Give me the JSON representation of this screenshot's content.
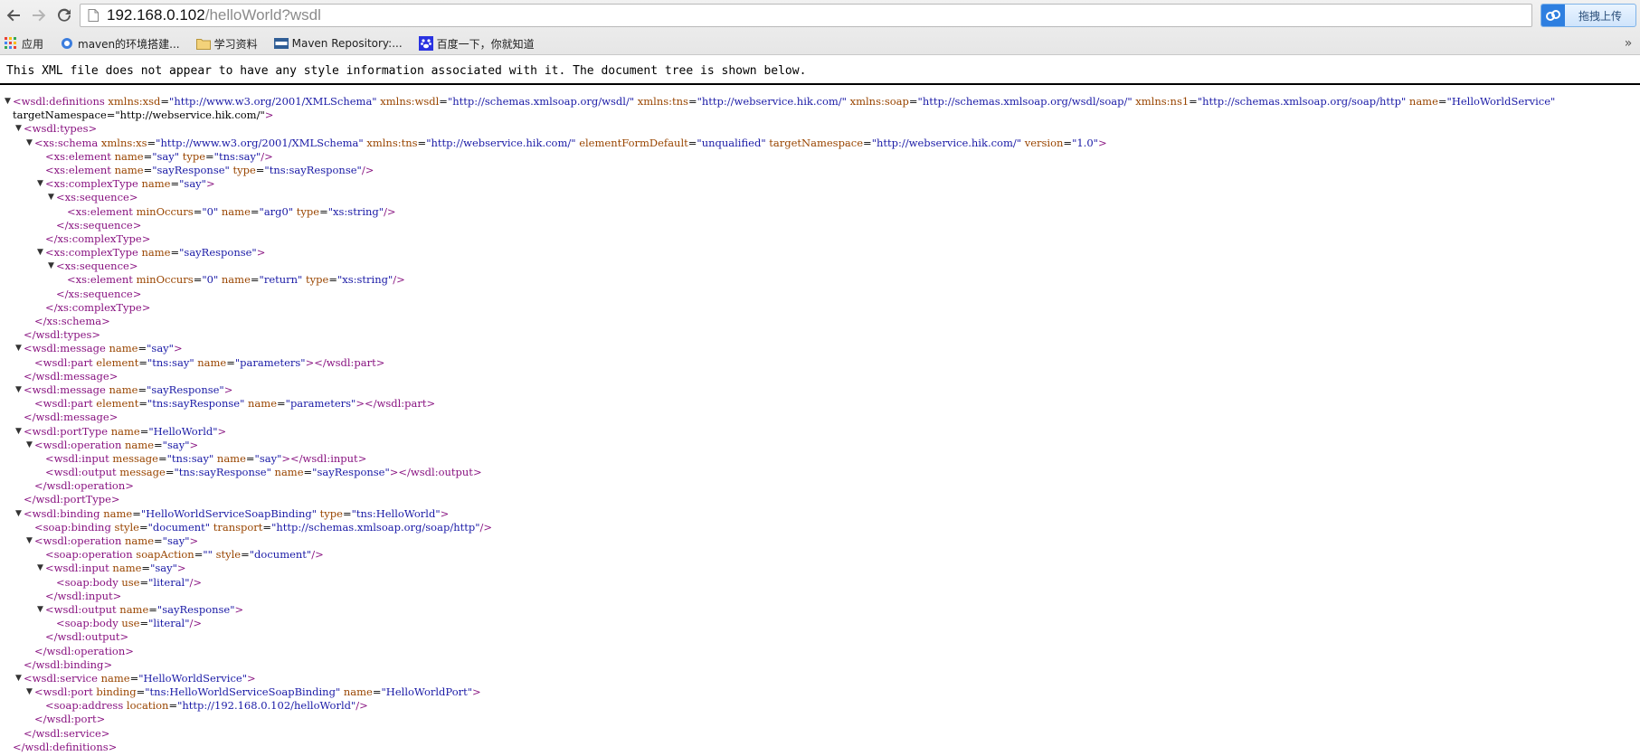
{
  "toolbar": {
    "back_icon": "back-arrow-icon",
    "forward_icon": "forward-arrow-icon",
    "reload_icon": "reload-icon",
    "url_host": "192.168.0.102",
    "url_path": "/helloWorld?wsdl",
    "extension_label": "拖拽上传",
    "extension_icon": "cloud-icon"
  },
  "bookmarks": [
    {
      "label": "应用",
      "icon": "apps-grid-icon"
    },
    {
      "label": "maven的环境搭建...",
      "icon": "globe-icon"
    },
    {
      "label": "学习资料",
      "icon": "folder-icon"
    },
    {
      "label": "Maven Repository:...",
      "icon": "mvn-icon"
    },
    {
      "label": "百度一下，你就知道",
      "icon": "baidu-paw-icon"
    }
  ],
  "info_banner": "This XML file does not appear to have any style information associated with it. The document tree is shown below.",
  "xml_lines": [
    {
      "indent": 0,
      "toggle": "▼",
      "text": "<wsdl:definitions xmlns:xsd=\"http://www.w3.org/2001/XMLSchema\" xmlns:wsdl=\"http://schemas.xmlsoap.org/wsdl/\" xmlns:tns=\"http://webservice.hik.com/\" xmlns:soap=\"http://schemas.xmlsoap.org/wsdl/soap/\" xmlns:ns1=\"http://schemas.xmlsoap.org/soap/http\" name=\"HelloWorldService\""
    },
    {
      "indent": 0,
      "toggle": "",
      "text": "targetNamespace=\"http://webservice.hik.com/\">"
    },
    {
      "indent": 1,
      "toggle": "▼",
      "text": "<wsdl:types>"
    },
    {
      "indent": 2,
      "toggle": "▼",
      "text": "<xs:schema xmlns:xs=\"http://www.w3.org/2001/XMLSchema\" xmlns:tns=\"http://webservice.hik.com/\" elementFormDefault=\"unqualified\" targetNamespace=\"http://webservice.hik.com/\" version=\"1.0\">"
    },
    {
      "indent": 3,
      "toggle": "",
      "text": "<xs:element name=\"say\" type=\"tns:say\"/>"
    },
    {
      "indent": 3,
      "toggle": "",
      "text": "<xs:element name=\"sayResponse\" type=\"tns:sayResponse\"/>"
    },
    {
      "indent": 3,
      "toggle": "▼",
      "text": "<xs:complexType name=\"say\">"
    },
    {
      "indent": 4,
      "toggle": "▼",
      "text": "<xs:sequence>"
    },
    {
      "indent": 5,
      "toggle": "",
      "text": "<xs:element minOccurs=\"0\" name=\"arg0\" type=\"xs:string\"/>"
    },
    {
      "indent": 4,
      "toggle": "",
      "text": "</xs:sequence>"
    },
    {
      "indent": 3,
      "toggle": "",
      "text": "</xs:complexType>"
    },
    {
      "indent": 3,
      "toggle": "▼",
      "text": "<xs:complexType name=\"sayResponse\">"
    },
    {
      "indent": 4,
      "toggle": "▼",
      "text": "<xs:sequence>"
    },
    {
      "indent": 5,
      "toggle": "",
      "text": "<xs:element minOccurs=\"0\" name=\"return\" type=\"xs:string\"/>"
    },
    {
      "indent": 4,
      "toggle": "",
      "text": "</xs:sequence>"
    },
    {
      "indent": 3,
      "toggle": "",
      "text": "</xs:complexType>"
    },
    {
      "indent": 2,
      "toggle": "",
      "text": "</xs:schema>"
    },
    {
      "indent": 1,
      "toggle": "",
      "text": "</wsdl:types>"
    },
    {
      "indent": 1,
      "toggle": "▼",
      "text": "<wsdl:message name=\"say\">"
    },
    {
      "indent": 2,
      "toggle": "",
      "text": "<wsdl:part element=\"tns:say\" name=\"parameters\"></wsdl:part>"
    },
    {
      "indent": 1,
      "toggle": "",
      "text": "</wsdl:message>"
    },
    {
      "indent": 1,
      "toggle": "▼",
      "text": "<wsdl:message name=\"sayResponse\">"
    },
    {
      "indent": 2,
      "toggle": "",
      "text": "<wsdl:part element=\"tns:sayResponse\" name=\"parameters\"></wsdl:part>"
    },
    {
      "indent": 1,
      "toggle": "",
      "text": "</wsdl:message>"
    },
    {
      "indent": 1,
      "toggle": "▼",
      "text": "<wsdl:portType name=\"HelloWorld\">"
    },
    {
      "indent": 2,
      "toggle": "▼",
      "text": "<wsdl:operation name=\"say\">"
    },
    {
      "indent": 3,
      "toggle": "",
      "text": "<wsdl:input message=\"tns:say\" name=\"say\"></wsdl:input>"
    },
    {
      "indent": 3,
      "toggle": "",
      "text": "<wsdl:output message=\"tns:sayResponse\" name=\"sayResponse\"></wsdl:output>"
    },
    {
      "indent": 2,
      "toggle": "",
      "text": "</wsdl:operation>"
    },
    {
      "indent": 1,
      "toggle": "",
      "text": "</wsdl:portType>"
    },
    {
      "indent": 1,
      "toggle": "▼",
      "text": "<wsdl:binding name=\"HelloWorldServiceSoapBinding\" type=\"tns:HelloWorld\">"
    },
    {
      "indent": 2,
      "toggle": "",
      "text": "<soap:binding style=\"document\" transport=\"http://schemas.xmlsoap.org/soap/http\"/>"
    },
    {
      "indent": 2,
      "toggle": "▼",
      "text": "<wsdl:operation name=\"say\">"
    },
    {
      "indent": 3,
      "toggle": "",
      "text": "<soap:operation soapAction=\"\" style=\"document\"/>"
    },
    {
      "indent": 3,
      "toggle": "▼",
      "text": "<wsdl:input name=\"say\">"
    },
    {
      "indent": 4,
      "toggle": "",
      "text": "<soap:body use=\"literal\"/>"
    },
    {
      "indent": 3,
      "toggle": "",
      "text": "</wsdl:input>"
    },
    {
      "indent": 3,
      "toggle": "▼",
      "text": "<wsdl:output name=\"sayResponse\">"
    },
    {
      "indent": 4,
      "toggle": "",
      "text": "<soap:body use=\"literal\"/>"
    },
    {
      "indent": 3,
      "toggle": "",
      "text": "</wsdl:output>"
    },
    {
      "indent": 2,
      "toggle": "",
      "text": "</wsdl:operation>"
    },
    {
      "indent": 1,
      "toggle": "",
      "text": "</wsdl:binding>"
    },
    {
      "indent": 1,
      "toggle": "▼",
      "text": "<wsdl:service name=\"HelloWorldService\">"
    },
    {
      "indent": 2,
      "toggle": "▼",
      "text": "<wsdl:port binding=\"tns:HelloWorldServiceSoapBinding\" name=\"HelloWorldPort\">"
    },
    {
      "indent": 3,
      "toggle": "",
      "text": "<soap:address location=\"http://192.168.0.102/helloWorld\"/>"
    },
    {
      "indent": 2,
      "toggle": "",
      "text": "</wsdl:port>"
    },
    {
      "indent": 1,
      "toggle": "",
      "text": "</wsdl:service>"
    },
    {
      "indent": 0,
      "toggle": "",
      "text": "</wsdl:definitions>"
    }
  ]
}
